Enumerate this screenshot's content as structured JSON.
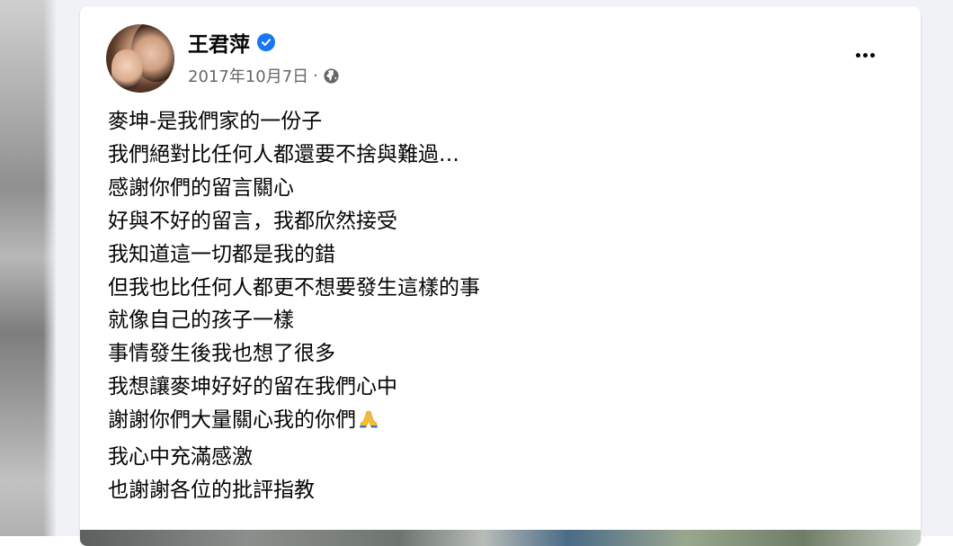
{
  "post": {
    "author": "王君萍",
    "date": "2017年10月7日",
    "separator": "·",
    "lines": [
      "麥坤-是我們家的一份子",
      "我們絕對比任何人都還要不捨與難過…",
      "感謝你們的留言關心",
      "好與不好的留言，我都欣然接受",
      "我知道這一切都是我的錯",
      "但我也比任何人都更不想要發生這樣的事",
      "就像自己的孩子一樣",
      "事情發生後我也想了很多",
      "我想讓麥坤好好的留在我們心中",
      "謝謝你們大量關心我的你們",
      "我心中充滿感激",
      "也謝謝各位的批評指教"
    ]
  },
  "icons": {
    "verified": "verified-badge-icon",
    "audience": "globe-icon",
    "more": "more-options-icon",
    "emoji": "folded-hands-emoji"
  },
  "colors": {
    "accent": "#1877f2",
    "text": "#050505",
    "secondary_text": "#65676b",
    "feed_background": "#f0f2f5"
  }
}
